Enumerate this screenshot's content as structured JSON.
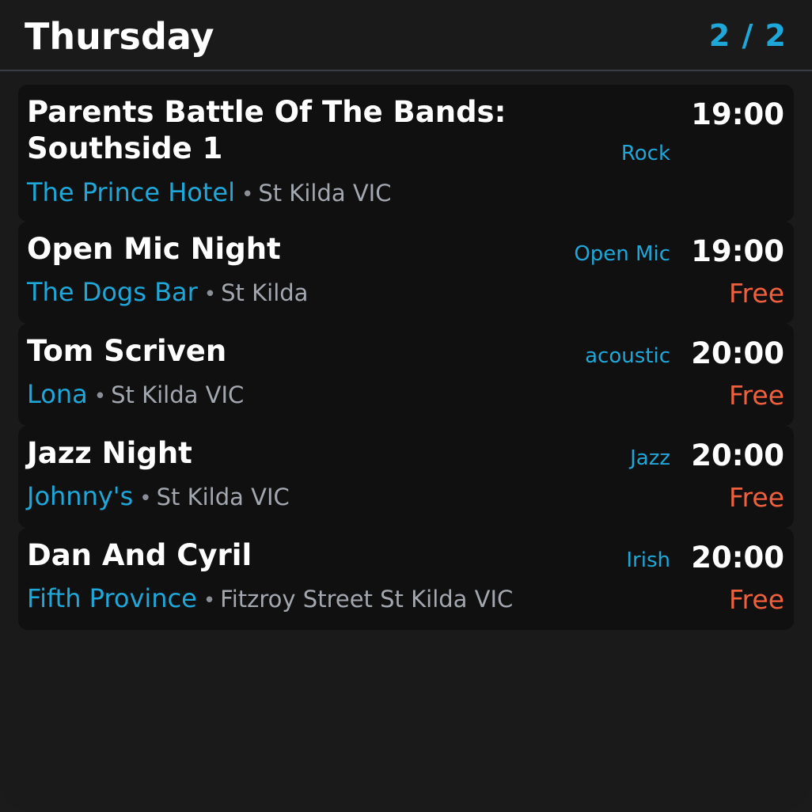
{
  "header": {
    "day": "Thursday",
    "page_indicator": "2 / 2"
  },
  "colors": {
    "accent": "#1ea7d8",
    "price": "#f0603c",
    "background": "#1a1a1a",
    "card": "#101010"
  },
  "events": [
    {
      "title": "Parents Battle Of The Bands: Southside 1",
      "venue": "The Prince Hotel",
      "separator": "•",
      "location": "St Kilda VIC",
      "genre": "Rock",
      "time": "19:00",
      "price": ""
    },
    {
      "title": "Open Mic Night",
      "venue": "The Dogs Bar",
      "separator": "•",
      "location": "St Kilda",
      "genre": "Open Mic",
      "time": "19:00",
      "price": "Free"
    },
    {
      "title": "Tom Scriven",
      "venue": "Lona",
      "separator": "•",
      "location": "St Kilda VIC",
      "genre": "acoustic",
      "time": "20:00",
      "price": "Free"
    },
    {
      "title": "Jazz Night",
      "venue": "Johnny's",
      "separator": "•",
      "location": "St Kilda VIC",
      "genre": "Jazz",
      "time": "20:00",
      "price": "Free"
    },
    {
      "title": "Dan And Cyril",
      "venue": "Fifth Province",
      "separator": "•",
      "location": "Fitzroy Street St Kilda VIC",
      "genre": "Irish",
      "time": "20:00",
      "price": "Free"
    }
  ]
}
